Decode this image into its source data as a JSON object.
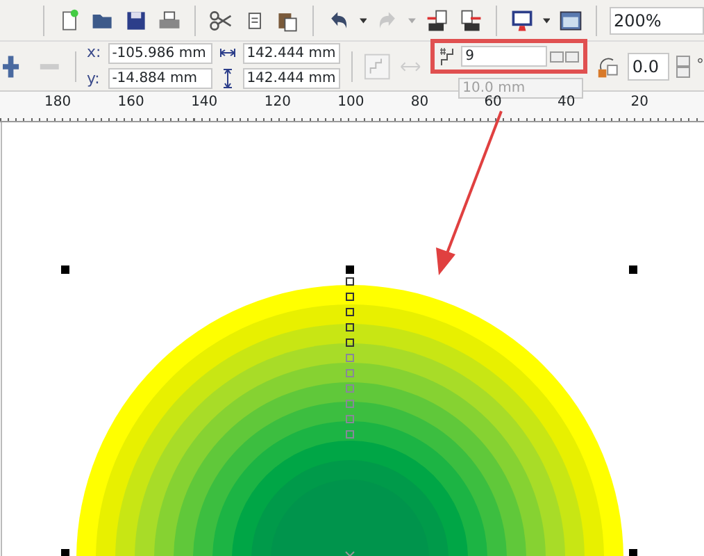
{
  "toolbar": {
    "zoom": "200%"
  },
  "property_bar": {
    "x_label": "x:",
    "x": "-105.986 mm",
    "y_label": "y:",
    "y": "-14.884 mm",
    "width": "142.444 mm",
    "height": "142.444 mm",
    "steps": "9",
    "steps_highlighted": true,
    "offset": "10.0 mm",
    "offset_disabled": true,
    "angle": "0.0",
    "angle_unit": "°"
  },
  "ruler": {
    "labels": [
      "180",
      "160",
      "140",
      "120",
      "100",
      "80",
      "60",
      "40",
      "20"
    ]
  },
  "annotation": {
    "arrow": true
  }
}
